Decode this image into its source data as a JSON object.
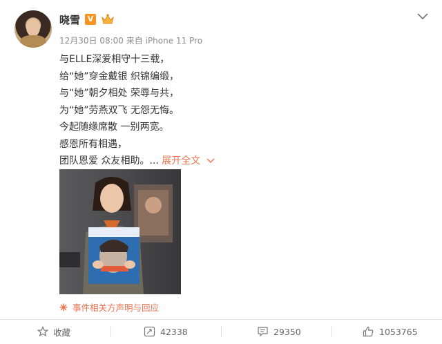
{
  "header": {
    "username": "晓雪",
    "verified_badge": "V",
    "timestamp": "12月30日 08:00",
    "source_prefix": "来自",
    "device": "iPhone 11 Pro"
  },
  "post": {
    "lines": [
      "与ELLE深爱相守十三载，",
      "给“她”穿金戴银 织锦编缎，",
      "与“她”朝夕相处 荣辱与共，",
      "为“她”劳燕双飞 无怨无悔。",
      "今起随缘席散  一别两宽。",
      "感恩所有相遇，",
      "团队恩爱 众友相助。..."
    ],
    "expand_label": "展开全文",
    "link_text": "事件相关方声明与回应"
  },
  "actions": {
    "favorite_label": "收藏",
    "repost_count": "42338",
    "comment_count": "29350",
    "like_count": "1053765"
  },
  "colors": {
    "accent": "#eb7350",
    "verified": "#f7931e",
    "muted": "#8c8c8c"
  },
  "icons": [
    "crown-icon",
    "chevron-down-icon",
    "star-icon",
    "repost-icon",
    "comment-icon",
    "like-icon",
    "link-icon"
  ]
}
